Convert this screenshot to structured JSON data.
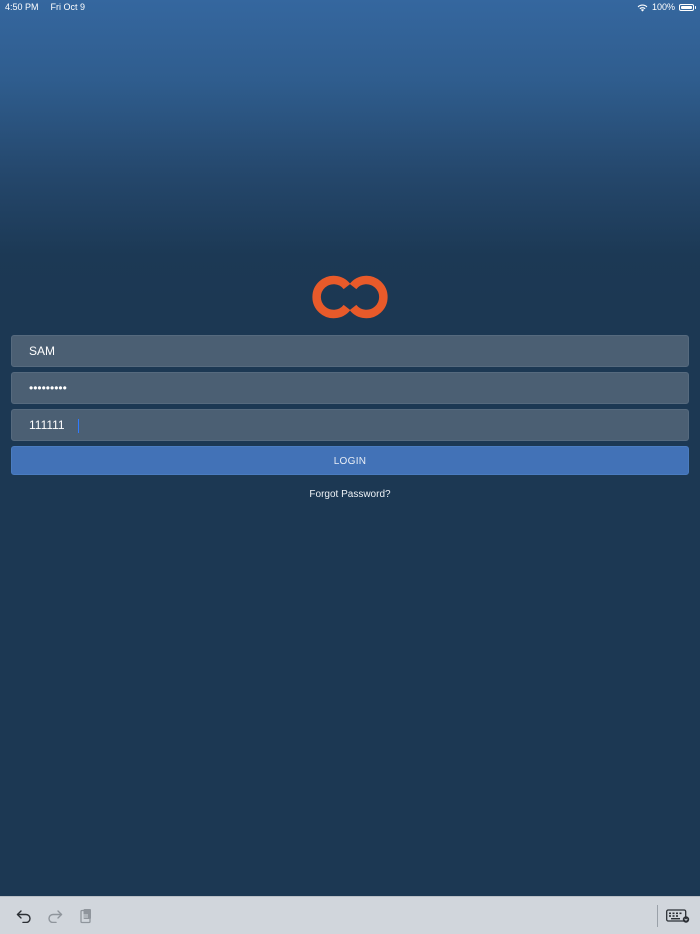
{
  "status_bar": {
    "time": "4:50 PM",
    "date": "Fri Oct 9",
    "battery_percent": "100%",
    "icons": [
      "wifi-icon",
      "battery-icon"
    ]
  },
  "logo": {
    "icon": "brand-logo",
    "color": "#e85a2a"
  },
  "form": {
    "username_value": "SAM",
    "password_value": "•••••••••",
    "code_value": "111111",
    "login_label": "LOGIN",
    "forgot_label": "Forgot Password?"
  },
  "shortcut_bar": {
    "icons": [
      "undo-icon",
      "redo-icon",
      "paste-icon",
      "keyboard-icon"
    ]
  },
  "colors": {
    "accent": "#4272b7",
    "field_bg": "#4b5f73",
    "background": "#1c3853",
    "brand": "#e85a2a"
  }
}
